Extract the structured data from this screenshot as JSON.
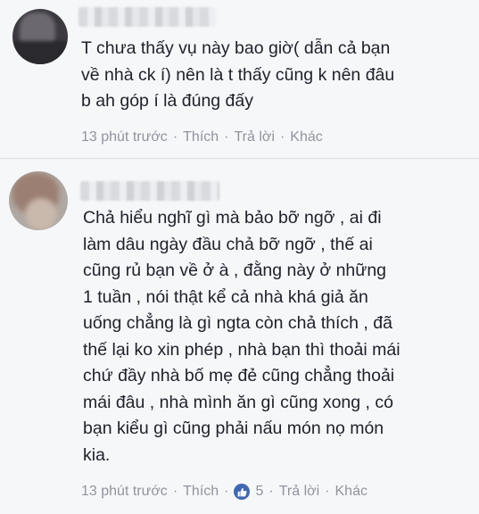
{
  "comments": [
    {
      "lines": [
        "T chưa thấy vụ này bao giờ( dẫn cả bạn",
        "về nhà ck í) nên là t thấy cũng k nên đâu",
        "b ah góp í là đúng đấy"
      ],
      "time": "13 phút trước",
      "like": "Thích",
      "reply": "Trả lời",
      "more": "Khác"
    },
    {
      "lines": [
        "Chả hiểu nghĩ gì mà bảo bỡ ngỡ , ai đi",
        "làm dâu ngày đầu chả bỡ ngỡ , thế ai",
        "cũng rủ bạn về ở à , đằng này ở những",
        "1 tuần , nói thật kể cả nhà khá giả ăn",
        "uống chẳng là gì ngta còn chả thích , đã",
        "thế lại ko xin phép , nhà bạn thì thoải mái",
        "chứ đầy nhà bố mẹ đẻ cũng chẳng thoải",
        "mái đâu , nhà mình ăn gì cũng xong , có",
        "bạn kiểu gì cũng phải nấu món nọ món",
        "kia."
      ],
      "time": "13 phút trước",
      "like": "Thích",
      "reaction_count": "5",
      "reply": "Trả lời",
      "more": "Khác"
    }
  ],
  "icons": {
    "like_reaction": "thumbs-up-icon"
  },
  "colors": {
    "text": "#1d2129",
    "meta": "#90949c",
    "like_blue": "#4267b2",
    "background": "#f6f7f9"
  }
}
